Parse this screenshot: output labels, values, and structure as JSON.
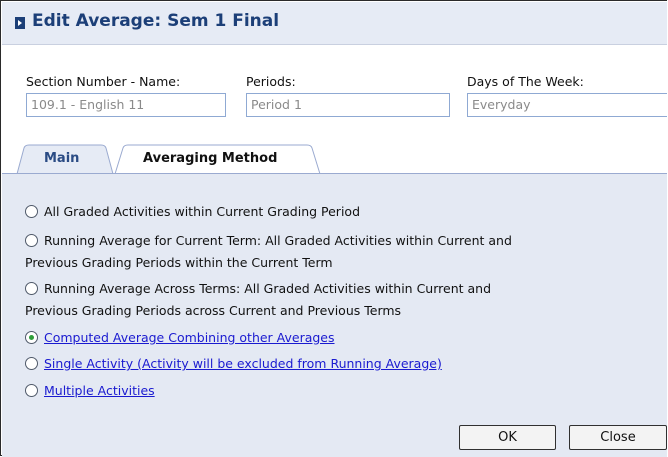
{
  "window": {
    "title": "Edit Average: Sem 1 Final"
  },
  "fields": {
    "section": {
      "label": "Section Number - Name:",
      "value": "109.1 - English 11"
    },
    "periods": {
      "label": "Periods:",
      "value": "Period 1"
    },
    "days": {
      "label": "Days of The Week:",
      "value": "Everyday"
    }
  },
  "tabs": [
    {
      "label": "Main",
      "active": false
    },
    {
      "label": "Averaging Method",
      "active": true
    }
  ],
  "options": [
    {
      "line1": "All Graded Activities within Current Grading Period",
      "line2": "",
      "selected": false,
      "link": false
    },
    {
      "line1": "Running Average for Current Term: All Graded Activities within Current and",
      "line2": "Previous Grading Periods within the Current Term",
      "selected": false,
      "link": false
    },
    {
      "line1": "Running Average Across Terms: All Graded Activities within Current and",
      "line2": "Previous Grading Periods across Current and Previous Terms",
      "selected": false,
      "link": false
    },
    {
      "line1": "Computed Average Combining other Averages",
      "line2": "",
      "selected": true,
      "link": true
    },
    {
      "line1": "Single Activity (Activity will be excluded from Running Average)",
      "line2": "",
      "selected": false,
      "link": true
    },
    {
      "line1": "Multiple Activities",
      "line2": "",
      "selected": false,
      "link": true
    }
  ],
  "buttons": {
    "ok": "OK",
    "close": "Close"
  },
  "colors": {
    "title": "#1c3f78",
    "panel": "#e4e9f3",
    "link": "#1a1ad0",
    "radio_selected": "#2f9e3a"
  }
}
